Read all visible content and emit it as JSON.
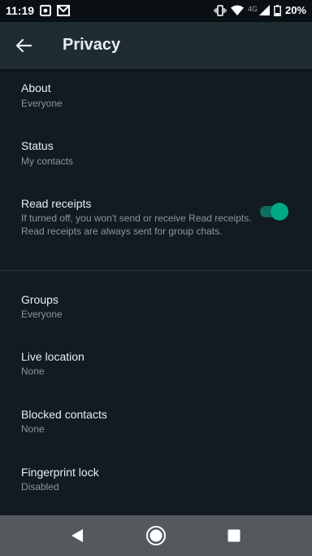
{
  "status_bar": {
    "time": "11:19",
    "network": "4G",
    "battery": "20%"
  },
  "header": {
    "title": "Privacy"
  },
  "settings": {
    "about": {
      "title": "About",
      "value": "Everyone"
    },
    "status": {
      "title": "Status",
      "value": "My contacts"
    },
    "read_receipts": {
      "title": "Read receipts",
      "description": "If turned off, you won't send or receive Read receipts. Read receipts are always sent for group chats.",
      "enabled": true
    },
    "groups": {
      "title": "Groups",
      "value": "Everyone"
    },
    "live_location": {
      "title": "Live location",
      "value": "None"
    },
    "blocked_contacts": {
      "title": "Blocked contacts",
      "value": "None"
    },
    "fingerprint_lock": {
      "title": "Fingerprint lock",
      "value": "Disabled"
    }
  },
  "colors": {
    "background": "#121b22",
    "app_bar": "#1f2c34",
    "accent": "#00a884",
    "primary_text": "#e9edef",
    "secondary_text": "#8696a0",
    "nav_bar": "#54595e"
  },
  "icons": {
    "back": "arrow-left-icon",
    "nav_back": "triangle-back-icon",
    "nav_home": "circle-home-icon",
    "nav_recents": "square-recents-icon"
  }
}
